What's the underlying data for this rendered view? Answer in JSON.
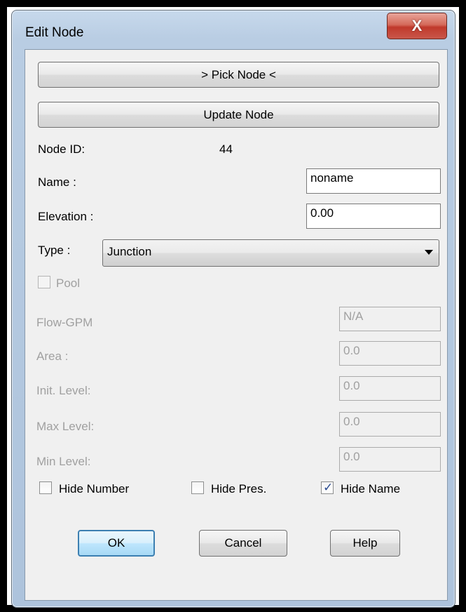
{
  "window": {
    "title": "Edit Node",
    "close_glyph": "X"
  },
  "buttons": {
    "pick_node": "> Pick Node <",
    "update_node": "Update Node",
    "ok": "OK",
    "cancel": "Cancel",
    "help": "Help"
  },
  "node": {
    "id_label": "Node ID:",
    "id_value": "44",
    "name_label": "Name  :",
    "name_value": "noname",
    "elevation_label": "Elevation  :",
    "elevation_value": "0.00",
    "type_label": "Type :",
    "type_value": "Junction"
  },
  "pool": {
    "label": "Pool",
    "checked": false,
    "enabled": false
  },
  "fields": {
    "flow_label": "Flow-GPM",
    "flow_value": "N/A",
    "area_label": "Area :",
    "area_value": "0.0",
    "init_level_label": "Init. Level:",
    "init_level_value": "0.0",
    "max_level_label": "Max Level:",
    "max_level_value": "0.0",
    "min_level_label": "Min Level:",
    "min_level_value": "0.0"
  },
  "options": {
    "hide_number": {
      "label": "Hide Number",
      "checked": false
    },
    "hide_pres": {
      "label": "Hide Pres.",
      "checked": false
    },
    "hide_name": {
      "label": "Hide Name",
      "checked": true
    }
  },
  "colors": {
    "close_button": "#c9574a",
    "default_button_border": "#3c7fb1",
    "disabled_text": "#a0a0a0"
  }
}
